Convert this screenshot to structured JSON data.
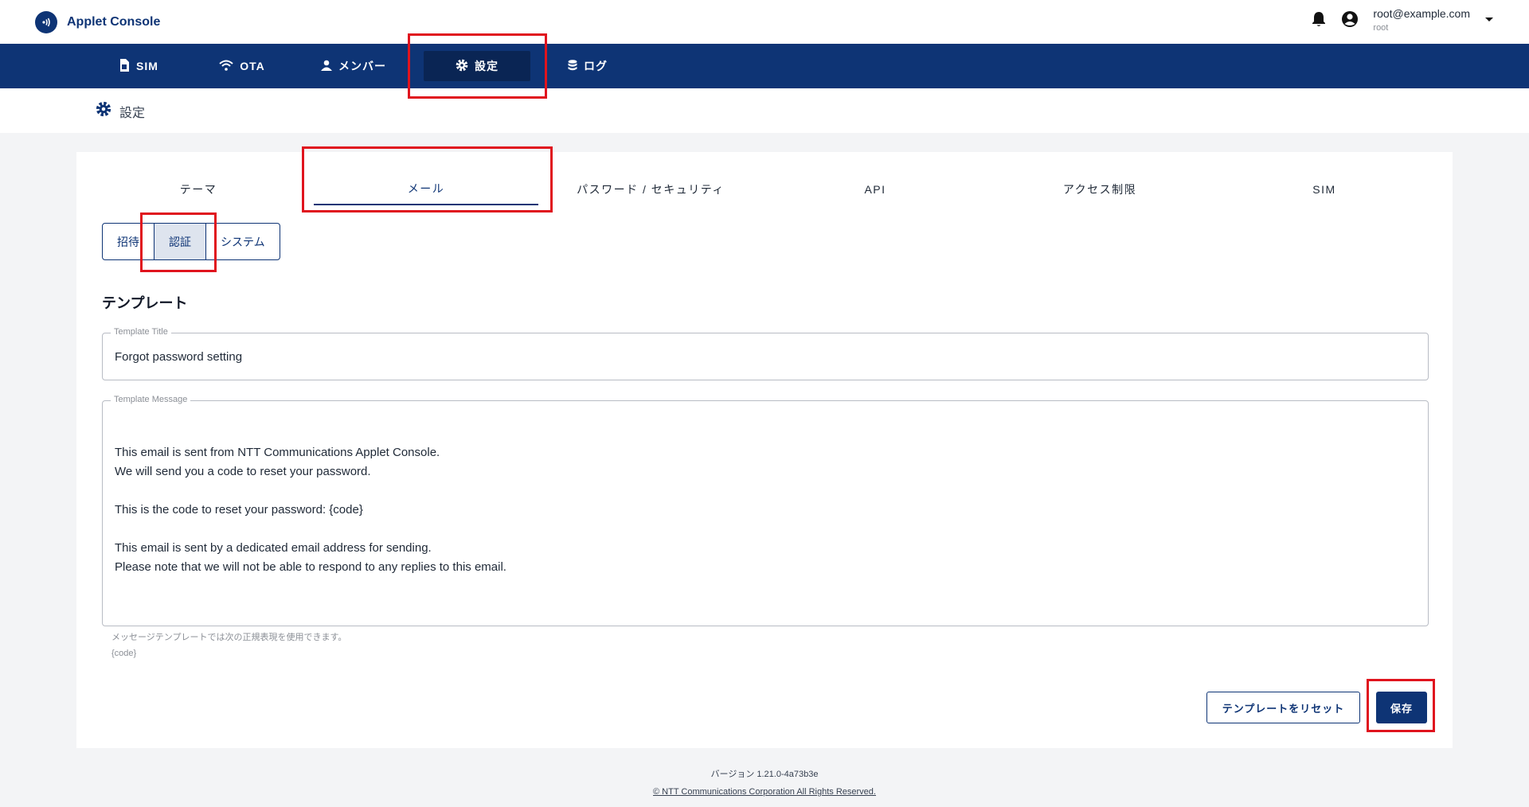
{
  "app": {
    "title": "Applet Console"
  },
  "user": {
    "email": "root@example.com",
    "role": "root"
  },
  "colors": {
    "brand": "#0e3475",
    "highlight": "#e0141e"
  },
  "nav": {
    "items": [
      {
        "label": "SIM",
        "icon": "sim-card-icon"
      },
      {
        "label": "OTA",
        "icon": "wifi-icon"
      },
      {
        "label": "メンバー",
        "icon": "person-icon"
      },
      {
        "label": "設定",
        "icon": "gear-icon",
        "active": true
      },
      {
        "label": "ログ",
        "icon": "database-icon"
      }
    ]
  },
  "page": {
    "title": "設定",
    "icon": "gear-icon"
  },
  "tabs": [
    {
      "label": "テーマ"
    },
    {
      "label": "メール",
      "active": true
    },
    {
      "label": "パスワード / セキュリティ"
    },
    {
      "label": "API"
    },
    {
      "label": "アクセス制限"
    },
    {
      "label": "SIM"
    }
  ],
  "subtabs": [
    {
      "label": "招待"
    },
    {
      "label": "認証",
      "active": true
    },
    {
      "label": "システム"
    }
  ],
  "template": {
    "section_title": "テンプレート",
    "title_label": "Template Title",
    "title_value": "Forgot password setting",
    "message_label": "Template Message",
    "message_lines": [
      "This email is sent from NTT Communications Applet Console.",
      "We will send you a code to reset your password.",
      "",
      "This is the code to reset your password: {code}",
      "",
      "This email is sent by a dedicated email address for sending.",
      "Please note that we will not be able to respond to any replies to this email."
    ],
    "helper_text": "メッセージテンプレートでは次の正規表現を使用できます。",
    "helper_code": "{code}"
  },
  "buttons": {
    "reset": "テンプレートをリセット",
    "save": "保存"
  },
  "footer": {
    "version": "バージョン 1.21.0-4a73b3e",
    "copyright": "© NTT Communications Corporation All Rights Reserved."
  }
}
